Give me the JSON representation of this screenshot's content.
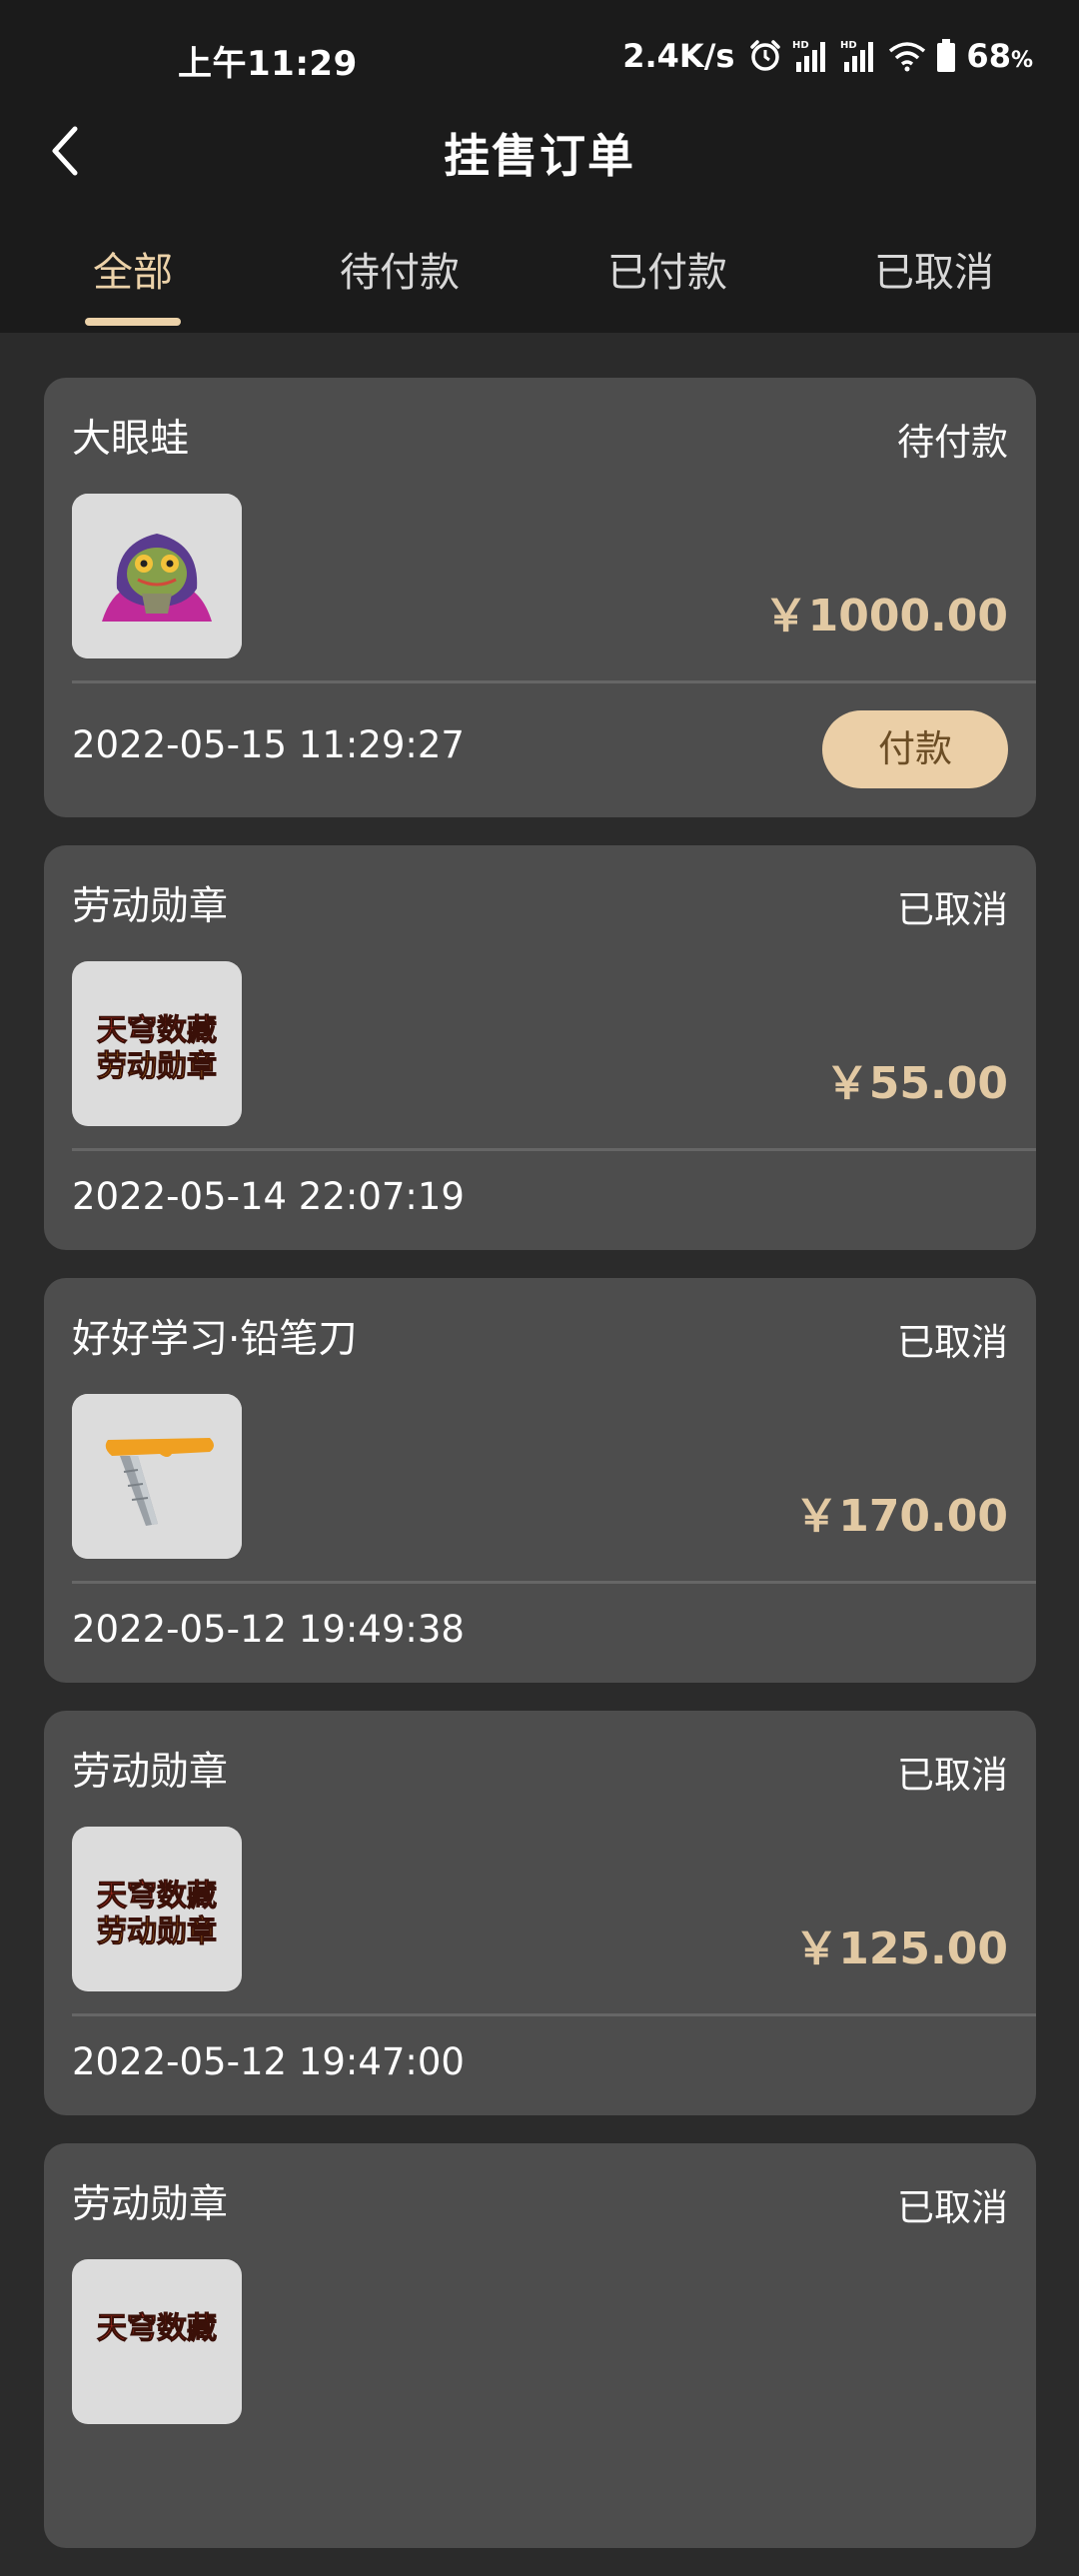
{
  "status_bar": {
    "time": "上午11:29",
    "net_speed": "2.4K/s",
    "battery": "68",
    "battery_unit": "%",
    "icons": [
      "alarm-icon",
      "signal-hd-icon",
      "signal-hd-icon",
      "wifi-icon",
      "battery-icon"
    ]
  },
  "header": {
    "title": "挂售订单",
    "back_icon": "chevron-left-icon"
  },
  "tabs": [
    {
      "label": "全部",
      "active": true
    },
    {
      "label": "待付款",
      "active": false
    },
    {
      "label": "已付款",
      "active": false
    },
    {
      "label": "已取消",
      "active": false
    }
  ],
  "orders": [
    {
      "name": "大眼蛙",
      "status": "待付款",
      "price": "￥1000.00",
      "time": "2022-05-15 11:29:27",
      "action": "付款",
      "thumb": "frog-hoodie-image"
    },
    {
      "name": "劳动勋章",
      "status": "已取消",
      "price": "￥55.00",
      "time": "2022-05-14 22:07:19",
      "thumb": "labor-medal-image",
      "thumb_text": [
        "天穹数藏",
        "劳动勋章"
      ]
    },
    {
      "name": "好好学习·铅笔刀",
      "status": "已取消",
      "price": "￥170.00",
      "time": "2022-05-12 19:49:38",
      "thumb": "pencil-knife-image"
    },
    {
      "name": "劳动勋章",
      "status": "已取消",
      "price": "￥125.00",
      "time": "2022-05-12 19:47:00",
      "thumb": "labor-medal-image",
      "thumb_text": [
        "天穹数藏",
        "劳动勋章"
      ]
    },
    {
      "name": "劳动勋章",
      "status": "已取消",
      "thumb": "labor-medal-image",
      "thumb_text": [
        "天穹数藏"
      ]
    }
  ],
  "colors": {
    "accent": "#ecd2a9",
    "price": "#e2c9a3",
    "card_bg": "#4d4d4d",
    "page_bg": "#2b2b2b",
    "header_bg": "#1b1b1b"
  }
}
